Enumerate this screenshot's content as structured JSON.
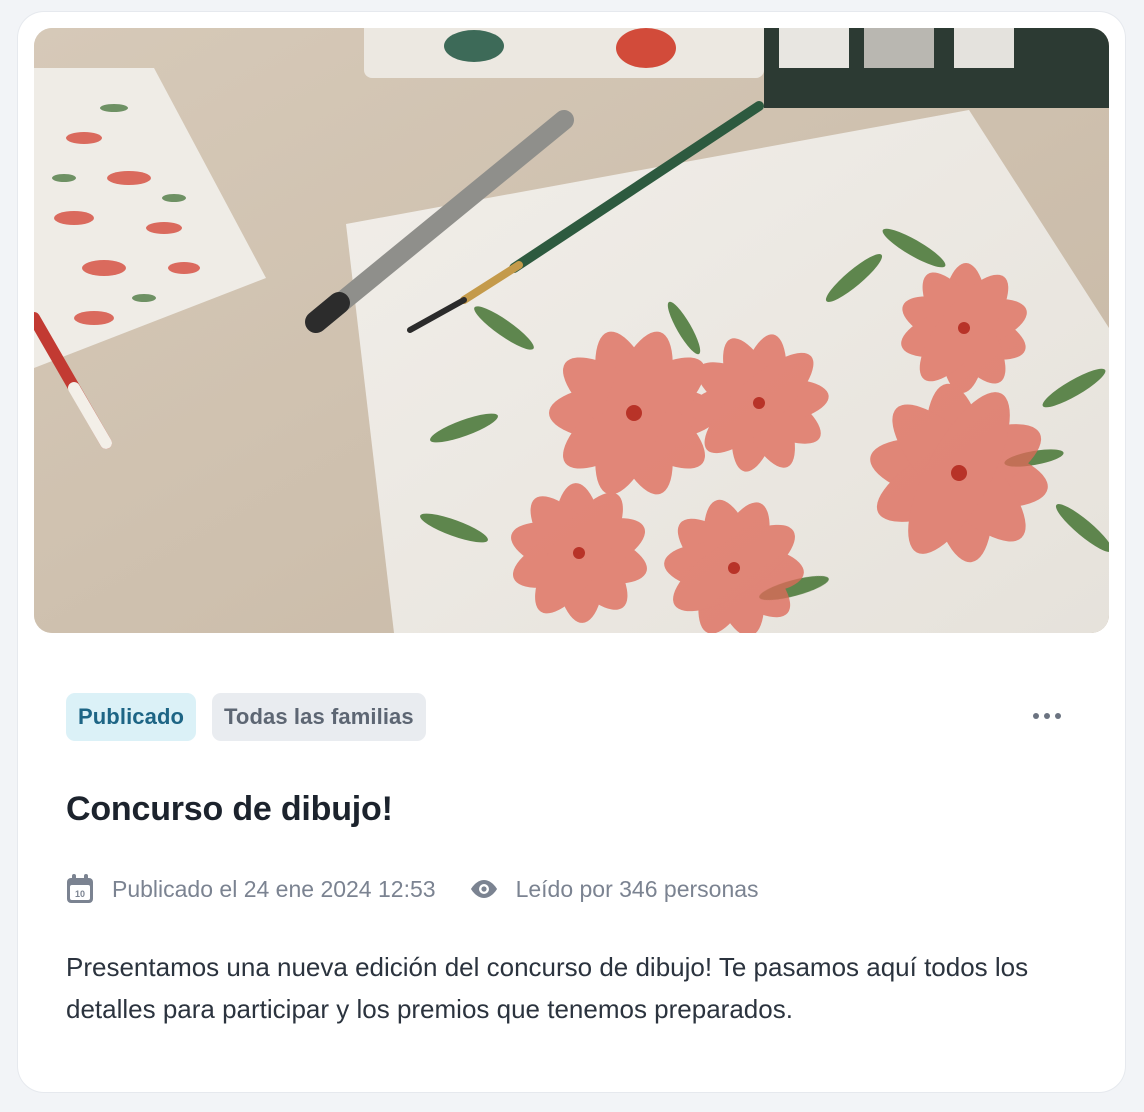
{
  "post": {
    "hero_image_alt": "Acuarela de flores rojas sobre papel con pinceles y pinturas",
    "tags": {
      "status": "Publicado",
      "audience": "Todas las familias"
    },
    "title": "Concurso de dibujo!",
    "meta": {
      "published": "Publicado el 24 ene 2024 12:53",
      "views": "Leído por 346 personas",
      "calendar_day": "10"
    },
    "description": "Presentamos una nueva edición del concurso de dibujo! Te pasamos aquí todos los detalles para participar y los premios que tenemos preparados."
  },
  "colors": {
    "status_bg": "#dbf1f7",
    "status_text": "#1d6585",
    "audience_bg": "#e9ecf0",
    "audience_text": "#5d6673"
  },
  "icons": [
    "more-horizontal-icon",
    "calendar-icon",
    "eye-icon"
  ]
}
